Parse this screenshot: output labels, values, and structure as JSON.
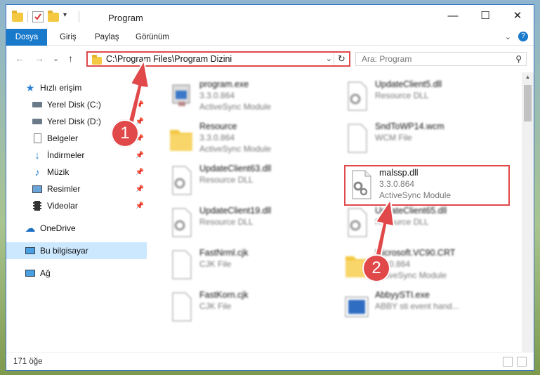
{
  "window": {
    "title": "Program"
  },
  "window_buttons": {
    "minimize": "—",
    "maximize": "☐",
    "close": "✕"
  },
  "ribbon": {
    "tabs": [
      "Dosya",
      "Giriş",
      "Paylaş",
      "Görünüm"
    ],
    "expand": "⌄",
    "help": "?"
  },
  "nav": {
    "back": "←",
    "forward": "→",
    "recent": "⌄",
    "up": "↑",
    "address": "C:\\Program Files\\Program Dizini",
    "address_dropdown": "⌄",
    "refresh": "↻",
    "search_placeholder": "Ara: Program",
    "search_icon": "⚲"
  },
  "sidebar": {
    "items": [
      {
        "label": "Hızlı erişim",
        "icon": "star-icon",
        "pinned": false
      },
      {
        "label": "Yerel Disk (C:)",
        "icon": "drive-icon",
        "pinned": true
      },
      {
        "label": "Yerel Disk (D:)",
        "icon": "drive-icon",
        "pinned": true
      },
      {
        "label": "Belgeler",
        "icon": "documents-icon",
        "pinned": true
      },
      {
        "label": "İndirmeler",
        "icon": "download-icon",
        "pinned": true
      },
      {
        "label": "Müzik",
        "icon": "music-icon",
        "pinned": true
      },
      {
        "label": "Resimler",
        "icon": "pictures-icon",
        "pinned": true
      },
      {
        "label": "Videolar",
        "icon": "videos-icon",
        "pinned": true
      },
      {
        "label": "OneDrive",
        "icon": "cloud-icon",
        "pinned": false
      },
      {
        "label": "Bu bilgisayar",
        "icon": "computer-icon",
        "pinned": false,
        "selected": true
      },
      {
        "label": "Ağ",
        "icon": "network-icon",
        "pinned": false
      }
    ]
  },
  "files": [
    {
      "name": "program.exe",
      "version": "3.3.0.864",
      "type": "ActiveSync Module",
      "icon": "exe-icon"
    },
    {
      "name": "UpdateClient5.dll",
      "version": "",
      "type": "Resource DLL",
      "icon": "dll-icon"
    },
    {
      "name": "Resource",
      "version": "3.3.0.864",
      "type": "ActiveSync Module",
      "icon": "folder-icon"
    },
    {
      "name": "SndToWP14.wcm",
      "version": "",
      "type": "WCM File",
      "icon": "file-icon"
    },
    {
      "name": "UpdateClient63.dll",
      "version": "",
      "type": "Resource DLL",
      "icon": "dll-icon"
    },
    {
      "name": "malssp.dll",
      "version": "3.3.0.864",
      "type": "ActiveSync Module",
      "icon": "dll-icon",
      "selected": true
    },
    {
      "name": "UpdateClient19.dll",
      "version": "",
      "type": "Resource DLL",
      "icon": "dll-icon"
    },
    {
      "name": "UpdateClient65.dll",
      "version": "",
      "type": "Resource DLL",
      "icon": "dll-icon"
    },
    {
      "name": "FastNrml.cjk",
      "version": "",
      "type": "CJK File",
      "icon": "file-icon"
    },
    {
      "name": "Microsoft.VC90.CRT",
      "version": "3.3.0.864",
      "type": "ActiveSync Module",
      "icon": "folder-icon"
    },
    {
      "name": "FastKorn.cjk",
      "version": "",
      "type": "CJK File",
      "icon": "file-icon"
    },
    {
      "name": "AbbyySTI.exe",
      "version": "",
      "type": "ABBY sti event hand...",
      "icon": "app-icon"
    }
  ],
  "status": {
    "count": "171 öğe"
  },
  "annotations": {
    "badge1": "1",
    "badge2": "2",
    "color": "#e0484a"
  }
}
